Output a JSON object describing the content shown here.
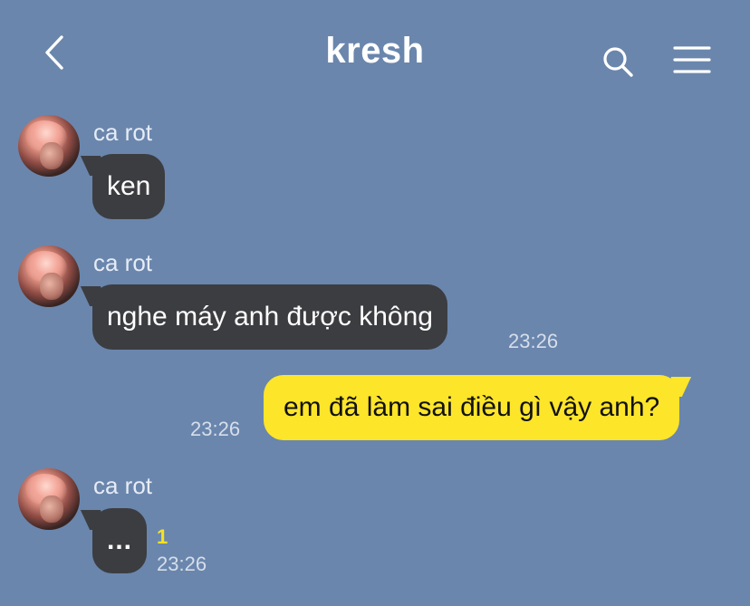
{
  "header": {
    "title": "kresh",
    "back_icon": "chevron-left-icon",
    "search_icon": "search-icon",
    "menu_icon": "hamburger-menu-icon"
  },
  "colors": {
    "background": "#6a86ad",
    "incoming_bubble": "#3c3d41",
    "outgoing_bubble": "#fde52a",
    "unread_count": "#f7e21f"
  },
  "messages": [
    {
      "sender": "ca rot",
      "text": "ken",
      "time": "",
      "direction": "incoming"
    },
    {
      "sender": "ca rot",
      "text": "nghe máy anh được không",
      "time": "23:26",
      "direction": "incoming"
    },
    {
      "sender": "",
      "text": "em đã làm sai điều gì vậy anh?",
      "time": "23:26",
      "direction": "outgoing"
    },
    {
      "sender": "ca rot",
      "text": "...",
      "time": "23:26",
      "unread": "1",
      "direction": "incoming"
    }
  ]
}
